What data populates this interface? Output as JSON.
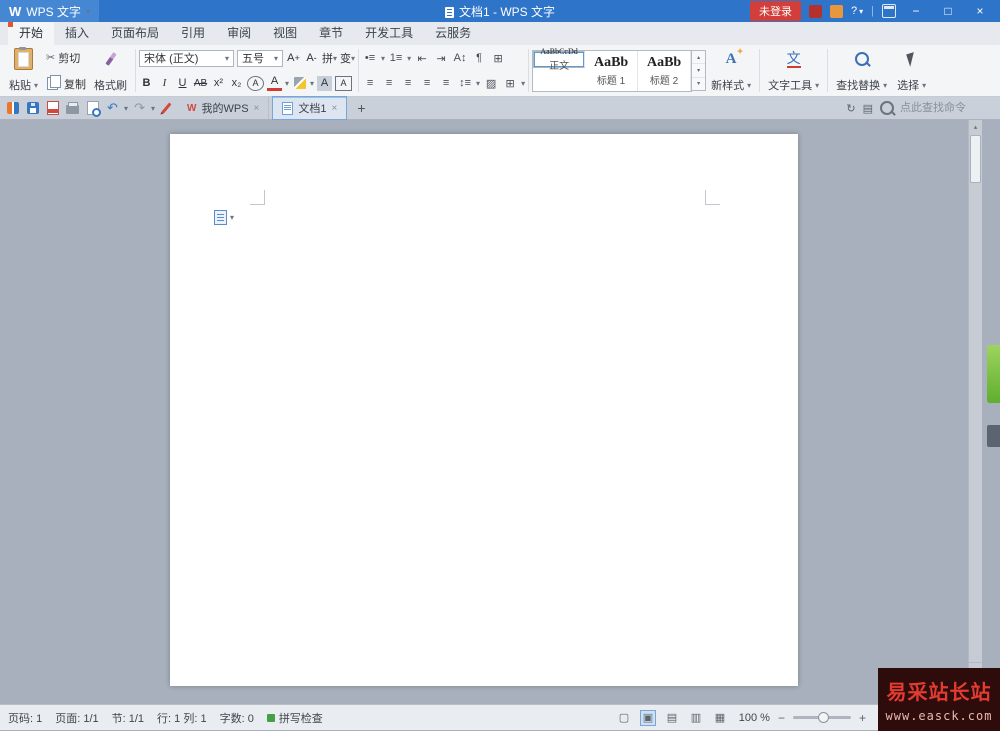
{
  "titlebar": {
    "logo": "W",
    "app_name": "WPS 文字",
    "doc_title": "文档1 - WPS 文字",
    "login": "未登录",
    "help": "?"
  },
  "ribbon_tabs": [
    "开始",
    "插入",
    "页面布局",
    "引用",
    "审阅",
    "视图",
    "章节",
    "开发工具",
    "云服务"
  ],
  "ribbon": {
    "paste": "粘贴",
    "cut": "剪切",
    "copy": "复制",
    "format_painter": "格式刷",
    "font_name": "宋体 (正文)",
    "font_size": "五号",
    "grow": "A",
    "grow_mark": "+",
    "shrink": "A",
    "shrink_mark": "-",
    "pinyin": "拼",
    "case_change": "变",
    "bold": "B",
    "italic": "I",
    "underline": "U",
    "strike": "AB",
    "superscript": "x²",
    "subscript": "x₂",
    "circle_char": "A",
    "font_color": "A",
    "char_shade": "A",
    "char_border": "A",
    "styles": [
      {
        "sample": "AaBbCcDd",
        "label": "正文"
      },
      {
        "sample": "AaBb",
        "label": "标题 1"
      },
      {
        "sample": "AaBb",
        "label": "标题 2"
      }
    ],
    "new_style": "新样式",
    "text_tool": "文字工具",
    "find_replace": "查找替换",
    "select": "选择"
  },
  "para": {
    "r1": [
      "•≡",
      "1≡",
      "⇤",
      "⇥",
      "A↕",
      "¶",
      "⊞"
    ],
    "r2": [
      "≡",
      "≡",
      "≡",
      "≡",
      "≡",
      "↕≡",
      "▨",
      "⊞"
    ]
  },
  "tabbar": {
    "doc_tabs": [
      "我的WPS",
      "文档1"
    ],
    "close": "×",
    "new_tab": "+",
    "search_placeholder": "点此查找命令"
  },
  "statusbar": {
    "items": [
      "页码: 1",
      "页面: 1/1",
      "节: 1/1",
      "行: 1 列: 1",
      "字数: 0"
    ],
    "spell": "拼写检查",
    "zoom": "100 %",
    "minus": "−",
    "plus": "+"
  },
  "watermark": {
    "title": "易采站长站",
    "url": "www.easck.com"
  },
  "glyphs": {
    "caret": "▾",
    "divider": "|",
    "min": "−",
    "max": "□",
    "close": "×",
    "scissors": "✂",
    "undo": "↶",
    "redo": "↷",
    "refresh": "↻",
    "panel": "▤",
    "up": "▴",
    "down": "▾",
    "v1": "▢",
    "v2": "▣",
    "v3": "▤",
    "v4": "▥",
    "v5": "▦"
  }
}
